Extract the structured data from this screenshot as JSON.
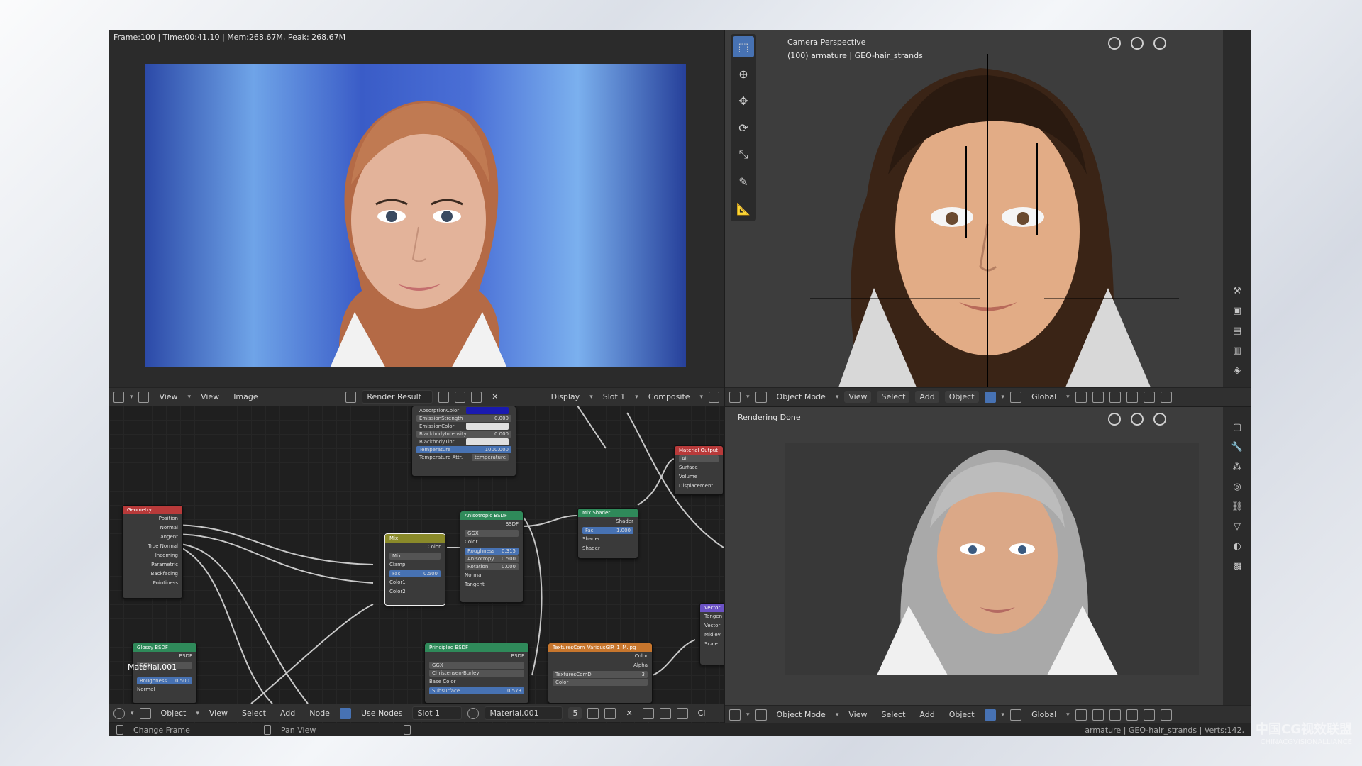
{
  "image_editor": {
    "render_info": "Frame:100 | Time:00:41.10 | Mem:268.67M, Peak: 268.67M",
    "header": {
      "view_menu": "View",
      "view": "View",
      "image": "Image",
      "image_name": "Render Result",
      "display": "Display",
      "slot": "Slot 1",
      "composite": "Composite"
    }
  },
  "node_editor": {
    "material_label": "Material.001",
    "header": {
      "object": "Object",
      "view": "View",
      "select": "Select",
      "add": "Add",
      "node": "Node",
      "use_nodes": "Use Nodes",
      "slot": "Slot 1",
      "material": "Material.001",
      "user_count": "5",
      "truncated": "Cl"
    },
    "nodes": {
      "principled_top": {
        "rows": [
          {
            "label": "AbsorptionColor",
            "value": ""
          },
          {
            "label": "EmissionStrength",
            "value": "0.000"
          },
          {
            "label": "EmissionColor",
            "value": ""
          },
          {
            "label": "BlackbodyIntensity",
            "value": "0.000"
          },
          {
            "label": "BlackbodyTint",
            "value": ""
          },
          {
            "label": "Temperature",
            "value": "1000.000"
          },
          {
            "label": "Temperature Attr.",
            "value": "temperature"
          }
        ]
      },
      "geometry": {
        "title": "Geometry",
        "outputs": [
          "Position",
          "Normal",
          "Tangent",
          "True Normal",
          "Incoming",
          "Parametric",
          "Backfacing",
          "Pointiness"
        ]
      },
      "mix": {
        "title": "Mix",
        "output": "Color",
        "blend": "Mix",
        "clamp": "Clamp",
        "fac_label": "Fac",
        "fac_value": "0.500",
        "color1": "Color1",
        "color2": "Color2"
      },
      "anisotropic": {
        "title": "Anisotropic BSDF",
        "output": "BSDF",
        "distribution": "GGX",
        "color": "Color",
        "roughness_label": "Roughness",
        "roughness_value": "0.315",
        "anisotropy_label": "Anisotropy",
        "anisotropy_value": "0.500",
        "rotation_label": "Rotation",
        "rotation_value": "0.000",
        "normal": "Normal",
        "tangent": "Tangent"
      },
      "mix_shader": {
        "title": "Mix Shader",
        "output": "Shader",
        "fac_label": "Fac",
        "fac_value": "1.000",
        "shader1": "Shader",
        "shader2": "Shader"
      },
      "material_output": {
        "title": "Material Output",
        "target": "All",
        "inputs": [
          "Surface",
          "Volume",
          "Displacement"
        ]
      },
      "vector": {
        "title": "Vector",
        "rows": [
          "Tangen",
          "Vector",
          "Midlev",
          "Scale"
        ]
      },
      "glossy": {
        "title": "Glossy BSDF",
        "output": "BSDF",
        "distribution": "GGX",
        "roughness_label": "Roughness",
        "roughness_value": "0.500",
        "normal": "Normal"
      },
      "principled_bottom": {
        "title": "Principled BSDF",
        "output": "BSDF",
        "distribution": "GGX",
        "subsurface_method": "Christensen-Burley",
        "base_color": "Base Color",
        "subsurface_label": "Subsurface",
        "subsurface_value": "0.573"
      },
      "texture": {
        "title": "TexturesCom_VariousGIR_1_M.jpg",
        "color": "Color",
        "alpha": "Alpha",
        "image_name": "TexturesComD",
        "user_count": "3",
        "colorspace": "Color"
      }
    }
  },
  "viewport_top": {
    "title": "Camera Perspective",
    "subtitle": "(100) armature | GEO-hair_strands",
    "header": {
      "mode": "Object Mode",
      "view": "View",
      "select": "Select",
      "add": "Add",
      "object": "Object",
      "orientation": "Global"
    }
  },
  "viewport_bottom": {
    "title": "Rendering Done",
    "header": {
      "mode": "Object Mode",
      "view": "View",
      "select": "Select",
      "add": "Add",
      "object": "Object",
      "orientation": "Global"
    }
  },
  "statusbar": {
    "change_frame": "Change Frame",
    "pan_view": "Pan View",
    "scene_stats": "armature | GEO-hair_strands | Verts:142,"
  },
  "watermark": {
    "line1": "中国CG视效联盟",
    "line2": "CHINACGVISIONALLIANCE"
  },
  "colors": {
    "accent": "#4772b3",
    "header_bg": "#303030",
    "node_geometry": "#b83a3a",
    "node_shader": "#2f8a5a",
    "node_converter": "#8a8a2a",
    "node_output": "#b83a3a",
    "node_texture": "#c7762d",
    "node_vector": "#6b52c4"
  }
}
